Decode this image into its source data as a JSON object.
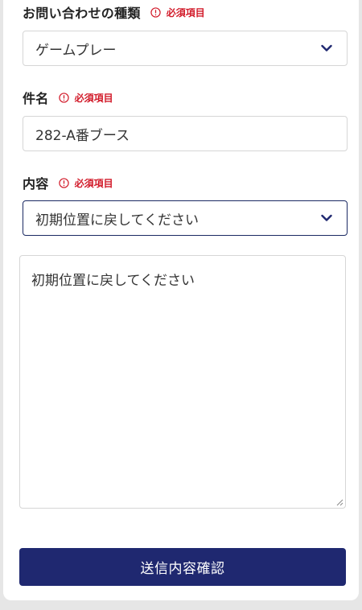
{
  "form": {
    "required_label": "必須項目",
    "inquiry_type": {
      "label": "お問い合わせの種類",
      "value": "ゲームプレー"
    },
    "subject": {
      "label": "件名",
      "value": "282-A番ブース"
    },
    "content": {
      "label": "内容",
      "value": "初期位置に戻してください",
      "body": "初期位置に戻してください"
    },
    "submit_label": "送信内容確認"
  },
  "colors": {
    "accent": "#1f2870",
    "required": "#d21c2b",
    "border": "#d6d6d6",
    "focus_border": "#1b2a63"
  },
  "icons": {
    "required": "alert-circle-icon",
    "dropdown": "chevron-down-icon",
    "resize": "resize-handle-icon"
  }
}
